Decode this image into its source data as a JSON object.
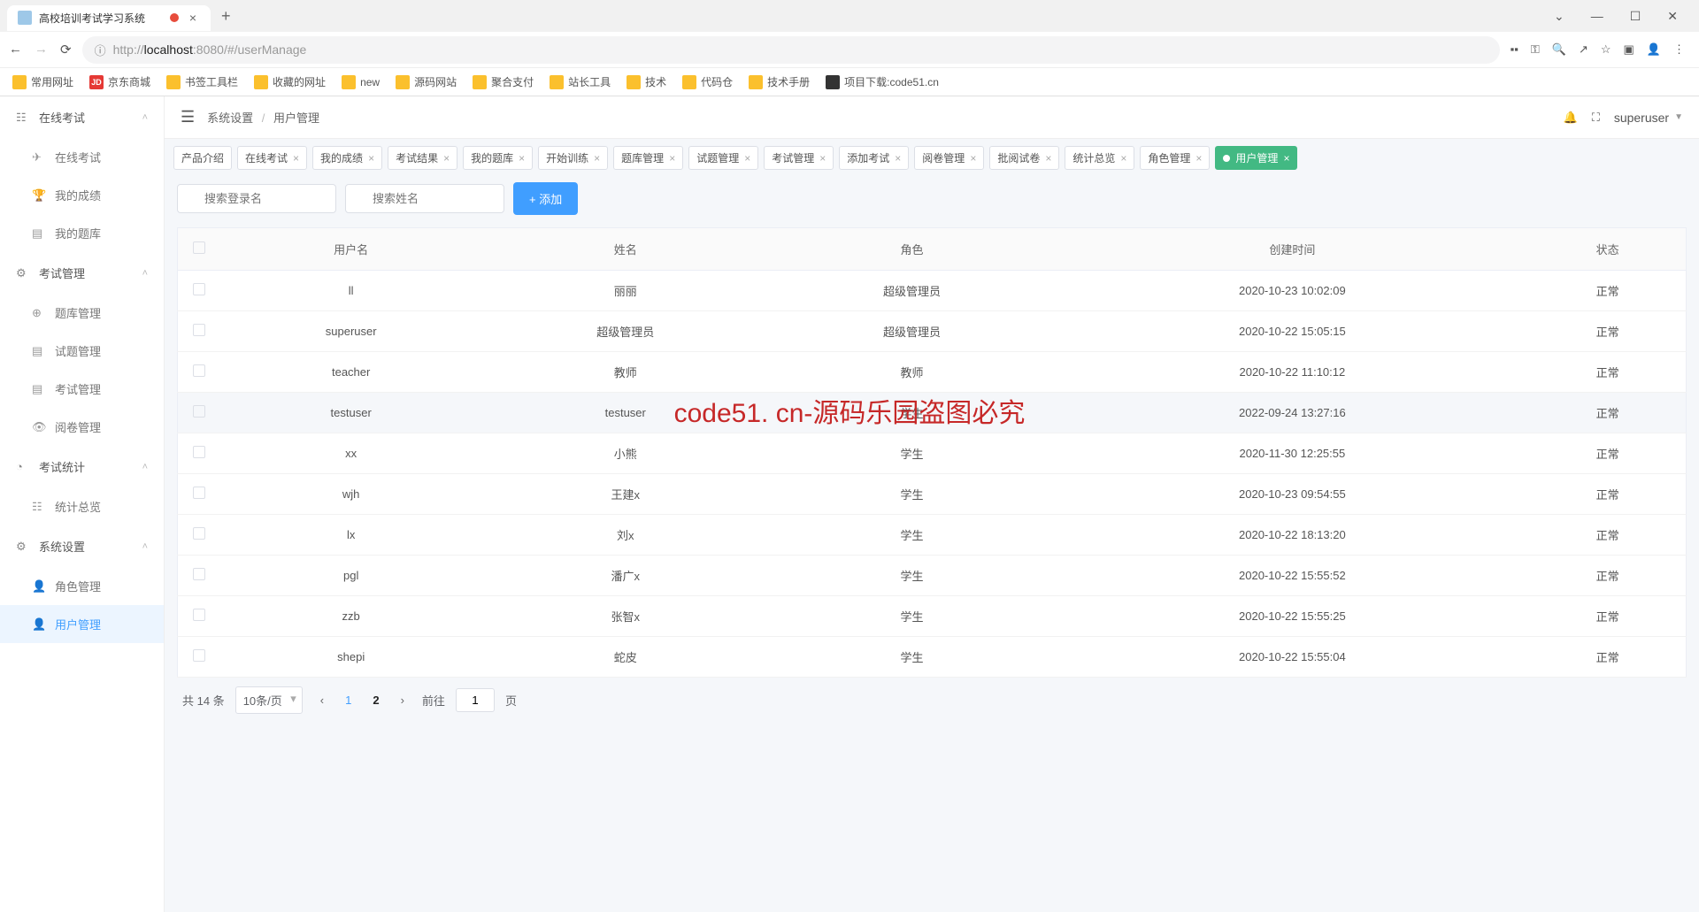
{
  "browser": {
    "tab_title": "高校培训考试学习系统",
    "url_proto": "http://",
    "url_host": "localhost",
    "url_port": ":8080",
    "url_path": "/#/userManage",
    "bookmarks": [
      "常用网址",
      "京东商城",
      "书签工具栏",
      "收藏的网址",
      "new",
      "源码网站",
      "聚合支付",
      "站长工具",
      "技术",
      "代码仓",
      "技术手册",
      "项目下载:code51.cn"
    ]
  },
  "sidebar": {
    "groups": [
      {
        "label": "在线考试",
        "items": [
          {
            "label": "在线考试",
            "ico": "✈"
          },
          {
            "label": "我的成绩",
            "ico": "🏆"
          },
          {
            "label": "我的题库",
            "ico": "▤"
          }
        ]
      },
      {
        "label": "考试管理",
        "items": [
          {
            "label": "题库管理",
            "ico": "⊕"
          },
          {
            "label": "试题管理",
            "ico": "▤"
          },
          {
            "label": "考试管理",
            "ico": "▤"
          },
          {
            "label": "阅卷管理",
            "ico": "👁"
          }
        ]
      },
      {
        "label": "考试统计",
        "items": [
          {
            "label": "统计总览",
            "ico": "☷"
          }
        ]
      },
      {
        "label": "系统设置",
        "items": [
          {
            "label": "角色管理",
            "ico": "👤",
            "active": false
          },
          {
            "label": "用户管理",
            "ico": "👤",
            "active": true
          }
        ]
      }
    ],
    "icons": {
      "g0": "☷",
      "g1": "⚙",
      "g2": "◔",
      "g3": "⚙"
    }
  },
  "topbar": {
    "crumb1": "系统设置",
    "crumb2": "用户管理",
    "user": "superuser"
  },
  "tabs": [
    "产品介绍",
    "在线考试",
    "我的成绩",
    "考试结果",
    "我的题库",
    "开始训练",
    "题库管理",
    "试题管理",
    "考试管理",
    "添加考试",
    "阅卷管理",
    "批阅试卷",
    "统计总览",
    "角色管理"
  ],
  "tabs_active": "用户管理",
  "toolbar": {
    "search1_ph": "搜索登录名",
    "search2_ph": "搜索姓名",
    "add_btn": "+ 添加"
  },
  "table": {
    "headers": [
      "",
      "用户名",
      "姓名",
      "角色",
      "创建时间",
      "状态"
    ],
    "rows": [
      {
        "user": "ll",
        "name": "丽丽",
        "role": "超级管理员",
        "created": "2020-10-23 10:02:09",
        "status": "正常"
      },
      {
        "user": "superuser",
        "name": "超级管理员",
        "role": "超级管理员",
        "created": "2020-10-22 15:05:15",
        "status": "正常"
      },
      {
        "user": "teacher",
        "name": "教师",
        "role": "教师",
        "created": "2020-10-22 11:10:12",
        "status": "正常"
      },
      {
        "user": "testuser",
        "name": "testuser",
        "role": "学生",
        "created": "2022-09-24 13:27:16",
        "status": "正常",
        "hl": true
      },
      {
        "user": "xx",
        "name": "小熊",
        "role": "学生",
        "created": "2020-11-30 12:25:55",
        "status": "正常"
      },
      {
        "user": "wjh",
        "name": "王建x",
        "role": "学生",
        "created": "2020-10-23 09:54:55",
        "status": "正常"
      },
      {
        "user": "lx",
        "name": "刘x",
        "role": "学生",
        "created": "2020-10-22 18:13:20",
        "status": "正常"
      },
      {
        "user": "pgl",
        "name": "潘广x",
        "role": "学生",
        "created": "2020-10-22 15:55:52",
        "status": "正常"
      },
      {
        "user": "zzb",
        "name": "张智x",
        "role": "学生",
        "created": "2020-10-22 15:55:25",
        "status": "正常"
      },
      {
        "user": "shepi",
        "name": "蛇皮",
        "role": "学生",
        "created": "2020-10-22 15:55:04",
        "status": "正常"
      }
    ]
  },
  "pagination": {
    "total_label": "共 14 条",
    "page_size": "10条/页",
    "pages": [
      "1",
      "2"
    ],
    "current": "1",
    "goto_label": "前往",
    "goto_val": "1",
    "goto_suffix": "页"
  },
  "watermark": "code51. cn-源码乐园盗图必究"
}
